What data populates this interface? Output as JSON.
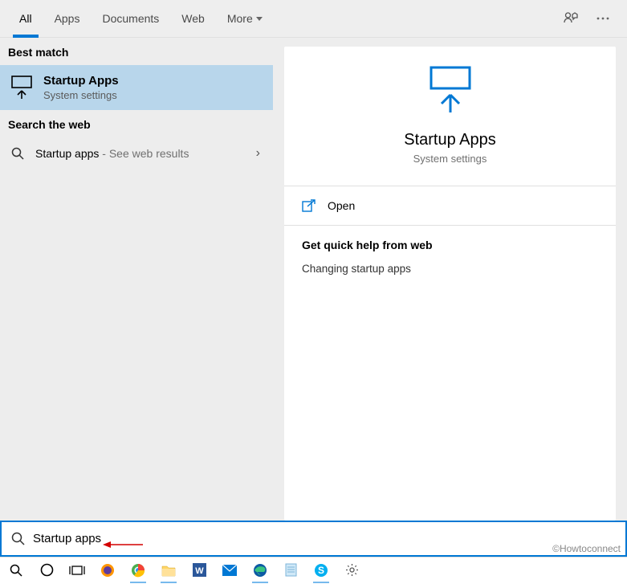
{
  "tabs": {
    "all": "All",
    "apps": "Apps",
    "documents": "Documents",
    "web": "Web",
    "more": "More"
  },
  "sections": {
    "best_match": "Best match",
    "search_web": "Search the web"
  },
  "best_match_result": {
    "title": "Startup Apps",
    "subtitle": "System settings"
  },
  "web_result": {
    "query": "Startup apps",
    "suffix": " - See web results"
  },
  "preview": {
    "title": "Startup Apps",
    "subtitle": "System settings"
  },
  "actions": {
    "open": "Open"
  },
  "help": {
    "heading": "Get quick help from web",
    "link1": "Changing startup apps"
  },
  "search": {
    "value": "Startup apps"
  },
  "watermark": "©Howtoconnect"
}
